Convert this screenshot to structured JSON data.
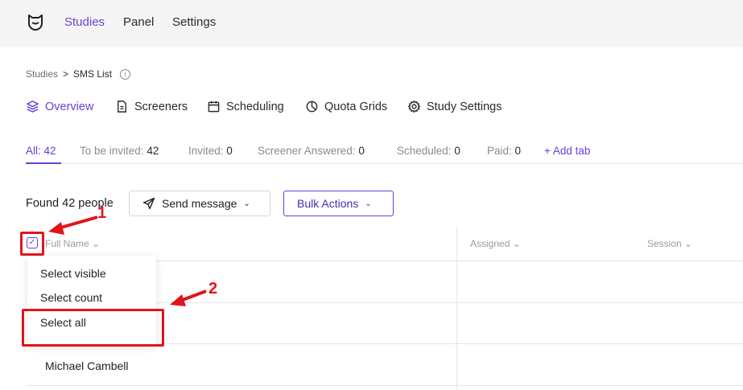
{
  "topnav": {
    "items": [
      {
        "label": "Studies",
        "active": true
      },
      {
        "label": "Panel",
        "active": false
      },
      {
        "label": "Settings",
        "active": false
      }
    ]
  },
  "breadcrumb": {
    "parent": "Studies",
    "separator": ">",
    "current": "SMS List",
    "info_glyph": "i"
  },
  "tabs": [
    {
      "label": "Overview",
      "icon": "stack-icon",
      "active": true
    },
    {
      "label": "Screeners",
      "icon": "document-icon",
      "active": false
    },
    {
      "label": "Scheduling",
      "icon": "calendar-icon",
      "active": false
    },
    {
      "label": "Quota Grids",
      "icon": "pie-chart-icon",
      "active": false
    },
    {
      "label": "Study Settings",
      "icon": "gear-icon",
      "active": false
    }
  ],
  "filters": [
    {
      "label": "All:",
      "count": "42",
      "active": true
    },
    {
      "label": "To be invited:",
      "count": "42",
      "active": false
    },
    {
      "label": "Invited:",
      "count": "0",
      "active": false
    },
    {
      "label": "Screener Answered:",
      "count": "0",
      "active": false
    },
    {
      "label": "Scheduled:",
      "count": "0",
      "active": false
    },
    {
      "label": "Paid:",
      "count": "0",
      "active": false
    }
  ],
  "add_tab": "+ Add tab",
  "toolbar": {
    "found": "Found 42 people",
    "send_message": "Send message",
    "bulk_actions": "Bulk Actions",
    "chevron": "⌄"
  },
  "table": {
    "columns": [
      "Full Name",
      "Assigned",
      "Session"
    ],
    "rows": [
      "Michael Cambell"
    ],
    "checkbox_glyph": "✓"
  },
  "select_menu": {
    "items": [
      "Select visible",
      "Select count",
      "Select all"
    ]
  },
  "annotations": {
    "step1": "1",
    "step2": "2"
  },
  "colors": {
    "accent": "#6a3fd6",
    "annotation": "#e0151a",
    "topbar_bg": "#f5f5f6"
  }
}
